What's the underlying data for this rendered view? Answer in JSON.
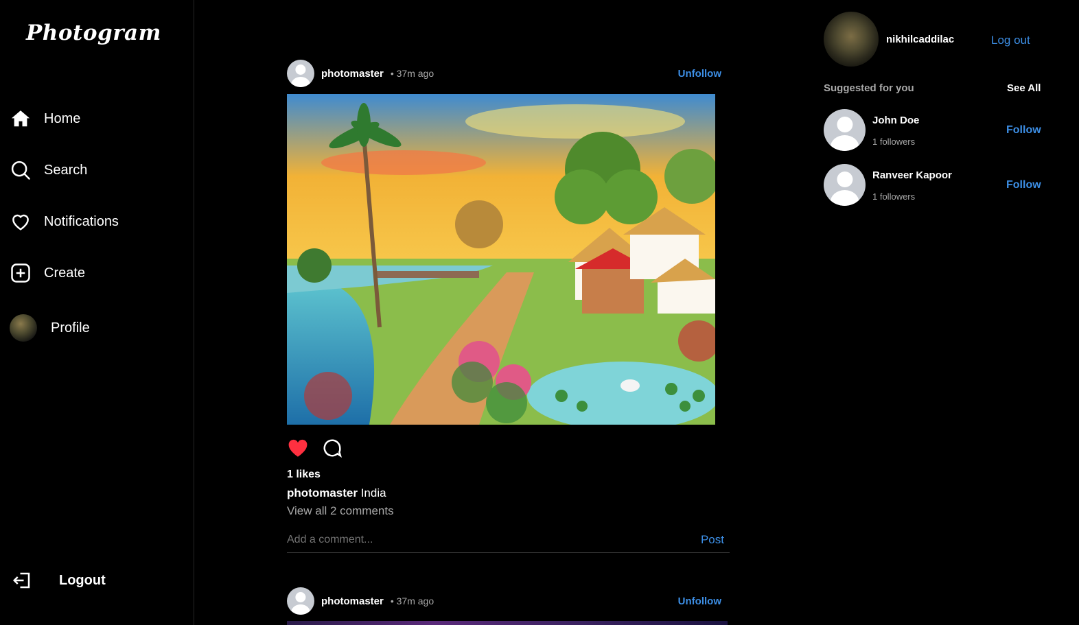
{
  "app": {
    "logo": "Photogram"
  },
  "sidebar": {
    "items": [
      {
        "label": "Home",
        "icon": "home-icon"
      },
      {
        "label": "Search",
        "icon": "search-icon"
      },
      {
        "label": "Notifications",
        "icon": "heart-icon"
      },
      {
        "label": "Create",
        "icon": "plus-square-icon"
      },
      {
        "label": "Profile",
        "icon": "avatar"
      }
    ],
    "logout": {
      "label": "Logout",
      "icon": "logout-icon"
    }
  },
  "feed": {
    "posts": [
      {
        "username": "photomaster",
        "time": "• 37m ago",
        "unfollow": "Unfollow",
        "image_alt": "Village landscape painting with palm trees, river, bridge, red-roofed houses and a swan pond",
        "likes": "1 likes",
        "caption_user": "photomaster",
        "caption_text": "India",
        "view_comments": "View all 2 comments",
        "comment_placeholder": "Add a comment...",
        "post_button": "Post",
        "liked": true
      },
      {
        "username": "photomaster",
        "time": "• 37m ago",
        "unfollow": "Unfollow"
      }
    ]
  },
  "right": {
    "me": {
      "username": "nikhilcaddilac",
      "logout": "Log out"
    },
    "suggested_title": "Suggested for you",
    "see_all": "See All",
    "suggestions": [
      {
        "name": "John Doe",
        "followers": "1 followers",
        "action": "Follow"
      },
      {
        "name": "Ranveer Kapoor",
        "followers": "1 followers",
        "action": "Follow"
      }
    ]
  },
  "colors": {
    "accent": "#3d8fe6",
    "like": "#ff3040",
    "background": "#000000"
  }
}
